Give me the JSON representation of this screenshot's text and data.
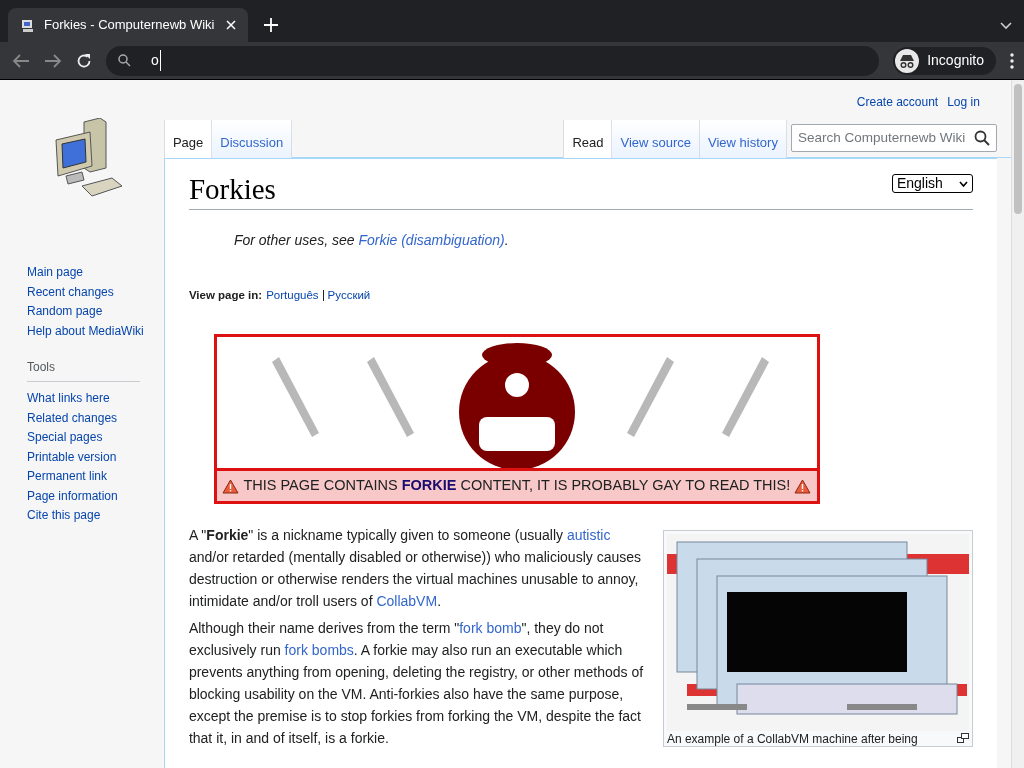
{
  "browser": {
    "tab_title": "Forkies - Computernewb Wiki",
    "address_value": "o",
    "profile_label": "Incognito"
  },
  "personal_links": [
    "Create account",
    "Log in"
  ],
  "namespace_tabs": [
    {
      "label": "Page",
      "selected": true
    },
    {
      "label": "Discussion",
      "selected": false
    }
  ],
  "view_tabs": [
    {
      "label": "Read",
      "selected": true
    },
    {
      "label": "View source",
      "selected": false
    },
    {
      "label": "View history",
      "selected": false
    }
  ],
  "search": {
    "placeholder": "Search Computernewb Wiki"
  },
  "sidebar": {
    "navigation": [
      "Main page",
      "Recent changes",
      "Random page",
      "Help about MediaWiki"
    ],
    "tools_heading": "Tools",
    "tools": [
      "What links here",
      "Related changes",
      "Special pages",
      "Printable version",
      "Permanent link",
      "Page information",
      "Cite this page"
    ]
  },
  "page": {
    "title": "Forkies",
    "language": "English",
    "hatnote": [
      {
        "kind": "text",
        "text": "For other uses, see "
      },
      {
        "kind": "link",
        "text": "Forkie (disambiguation)"
      },
      {
        "kind": "text",
        "text": "."
      }
    ],
    "view_in_label": "View page in:",
    "view_in_languages": [
      "Português",
      "Русский"
    ],
    "banner_text": "THIS PAGE CONTAINS **FORKIE** CONTENT, IT IS PROBABLY GAY TO READ THIS!",
    "paragraphs": [
      [
        {
          "kind": "text",
          "text": "A \""
        },
        {
          "kind": "bold",
          "text": "Forkie"
        },
        {
          "kind": "text",
          "text": "\" is a nickname typically given to someone (usually "
        },
        {
          "kind": "link",
          "text": "autistic"
        },
        {
          "kind": "text",
          "text": " and/or retarded (mentally disabled or otherwise)) who maliciously causes destruction or otherwise renders the virtual machines unusable to annoy, intimidate and/or troll users of "
        },
        {
          "kind": "link",
          "text": "CollabVM"
        },
        {
          "kind": "text",
          "text": "."
        }
      ],
      [
        {
          "kind": "text",
          "text": "Although their name derives from the term \""
        },
        {
          "kind": "link",
          "text": "fork bomb"
        },
        {
          "kind": "text",
          "text": "\", they do not exclusively run "
        },
        {
          "kind": "link",
          "text": "fork bombs"
        },
        {
          "kind": "text",
          "text": ". A forkie may also run an executable which prevents anything from opening, deleting the registry, or other methods of blocking usability on the VM. Anti-forkies also have the same purpose, except the premise is to stop forkies from forking the VM, despite the fact that it, in and of itself, is a forkie."
        }
      ]
    ],
    "thumbnail": {
      "kind": "picture",
      "caption": "An example of a CollabVM machine after being"
    }
  }
}
